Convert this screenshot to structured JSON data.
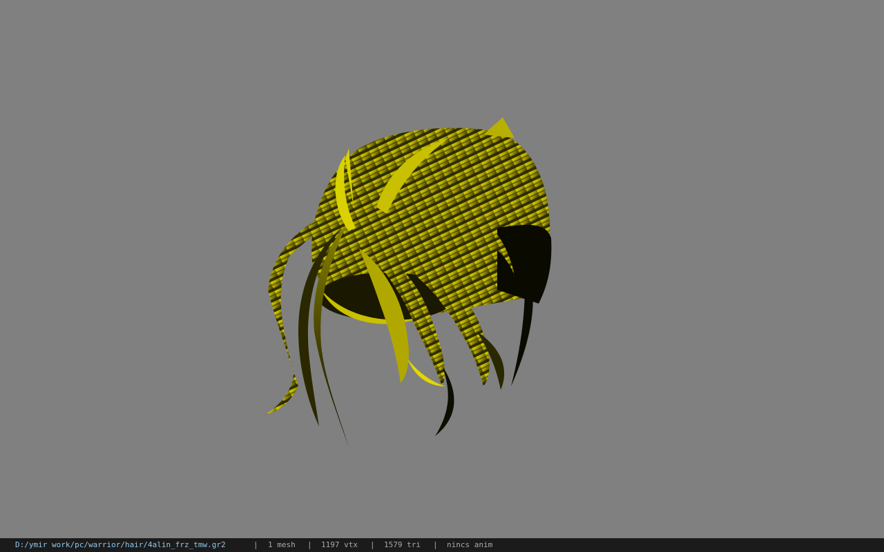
{
  "viewport": {
    "background_color": "#808080",
    "model_color": "#d9d200",
    "model_shadow_color": "#0d0d00"
  },
  "statusbar": {
    "file_path": "D:/ymir work/pc/warrior/hair/4alin_frz_tmw.gr2",
    "separator": "|",
    "mesh_count": "1 mesh",
    "vertex_count": "1197 vtx",
    "triangle_count": "1579 tri",
    "animation": "nincs anim"
  }
}
